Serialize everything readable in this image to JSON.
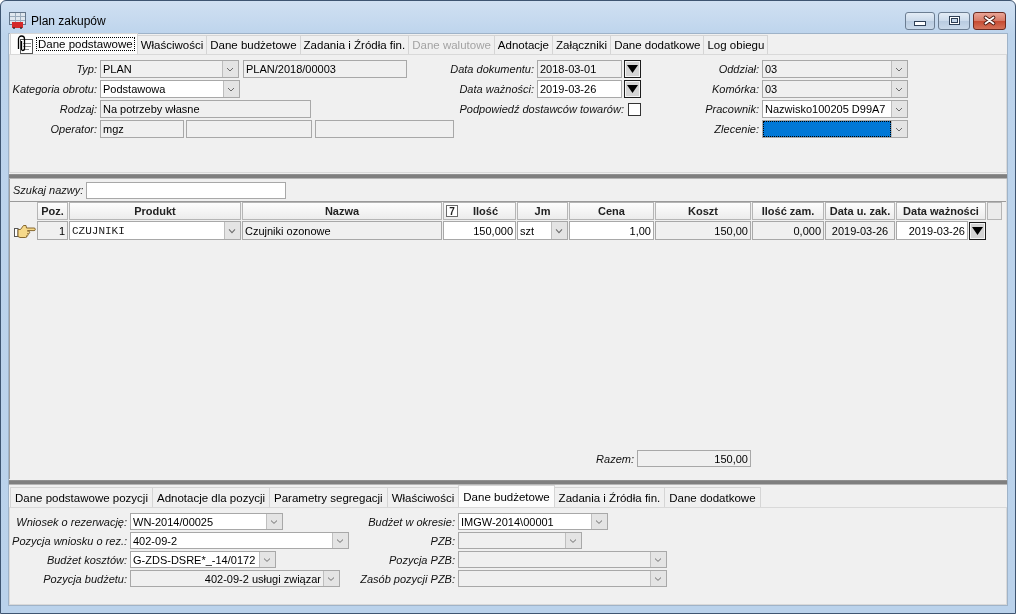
{
  "window": {
    "title": "Plan zakupów"
  },
  "tabs": [
    {
      "label": "Dane podstawowe",
      "selected": true,
      "disabled": false
    },
    {
      "label": "Właściwości",
      "selected": false,
      "disabled": false
    },
    {
      "label": "Dane budżetowe",
      "selected": false,
      "disabled": false
    },
    {
      "label": "Zadania i Źródła fin.",
      "selected": false,
      "disabled": false
    },
    {
      "label": "Dane walutowe",
      "selected": false,
      "disabled": true
    },
    {
      "label": "Adnotacje",
      "selected": false,
      "disabled": false
    },
    {
      "label": "Załączniki",
      "selected": false,
      "disabled": false
    },
    {
      "label": "Dane dodatkowe",
      "selected": false,
      "disabled": false
    },
    {
      "label": "Log obiegu",
      "selected": false,
      "disabled": false
    }
  ],
  "header_form": {
    "left": [
      {
        "label": "Typ:",
        "controls": [
          {
            "kind": "combo",
            "value": "PLAN",
            "readonly": true
          },
          {
            "kind": "text",
            "value": "PLAN/2018/00003",
            "readonly": true
          }
        ]
      },
      {
        "label": "Kategoria obrotu:",
        "controls": [
          {
            "kind": "combo",
            "value": "Podstawowa",
            "readonly": false
          }
        ]
      },
      {
        "label": "Rodzaj:",
        "controls": [
          {
            "kind": "text",
            "value": "Na potrzeby własne",
            "readonly": true
          }
        ]
      },
      {
        "label": "Operator:",
        "controls": [
          {
            "kind": "text",
            "value": "mgz",
            "readonly": true
          },
          {
            "kind": "text",
            "readonly": true
          },
          {
            "kind": "text",
            "readonly": true
          }
        ]
      }
    ],
    "middle": [
      {
        "label": "Data dokumentu:",
        "kind": "date",
        "value": "2018-03-01",
        "readonly": true
      },
      {
        "label": "Data ważności:",
        "kind": "date",
        "value": "2019-03-26",
        "readonly": false
      },
      {
        "label": "Podpowiedź dostawców towarów:",
        "kind": "checkbox",
        "checked": false
      }
    ],
    "right": [
      {
        "label": "Oddział:",
        "kind": "combo",
        "value": "03",
        "readonly": true,
        "focused": false
      },
      {
        "label": "Komórka:",
        "kind": "combo",
        "value": "03",
        "readonly": true,
        "focused": false
      },
      {
        "label": "Pracownik:",
        "kind": "combo",
        "value": "Nazwisko100205 D99A7",
        "readonly": false,
        "focused": false
      },
      {
        "label": "Zlecenie:",
        "kind": "combo",
        "readonly": false,
        "focused": true
      }
    ]
  },
  "search": {
    "label": "Szukaj nazwy:"
  },
  "table": {
    "columns": [
      {
        "label": "Poz."
      },
      {
        "label": "Produkt"
      },
      {
        "label": "Nazwa"
      },
      {
        "label": "Ilość",
        "badge": "7"
      },
      {
        "label": "Jm"
      },
      {
        "label": "Cena"
      },
      {
        "label": "Koszt"
      },
      {
        "label": "Ilość zam."
      },
      {
        "label": "Data u. zak."
      },
      {
        "label": "Data ważności"
      }
    ],
    "rows": [
      {
        "current": true,
        "cells": [
          {
            "kind": "text",
            "value": "1",
            "readonly": true
          },
          {
            "kind": "combo",
            "value": "CZUJNIKI",
            "readonly": false
          },
          {
            "kind": "text",
            "value": "Czujniki ozonowe",
            "readonly": true
          },
          {
            "kind": "text",
            "value": "150,000",
            "readonly": false
          },
          {
            "kind": "combo",
            "value": "szt",
            "readonly": false
          },
          {
            "kind": "text",
            "value": "1,00",
            "readonly": false
          },
          {
            "kind": "text",
            "value": "150,00",
            "readonly": true
          },
          {
            "kind": "text",
            "value": "0,000",
            "readonly": true
          },
          {
            "kind": "text",
            "value": "2019-03-26",
            "readonly": true
          },
          {
            "kind": "date",
            "value": "2019-03-26",
            "readonly": false
          }
        ]
      }
    ]
  },
  "total": {
    "label": "Razem:",
    "value": "150,00"
  },
  "detail_tabs": [
    {
      "label": "Dane podstawowe pozycji",
      "selected": false
    },
    {
      "label": "Adnotacje dla pozycji",
      "selected": false
    },
    {
      "label": "Parametry segregacji",
      "selected": false
    },
    {
      "label": "Właściwości",
      "selected": false
    },
    {
      "label": "Dane budżetowe",
      "selected": true
    },
    {
      "label": "Zadania i Źródła fin.",
      "selected": false
    },
    {
      "label": "Dane dodatkowe",
      "selected": false
    }
  ],
  "detail_form": {
    "left": [
      {
        "label": "Wniosek o rezerwację:",
        "kind": "combo",
        "value": "WN-2014/00025",
        "readonly": false
      },
      {
        "label": "Pozycja wniosku o rez.:",
        "kind": "combo",
        "value": "402-09-2",
        "readonly": false
      },
      {
        "label": "Budżet kosztów:",
        "kind": "combo",
        "value": "G-ZDS-DSRE*_-14/0172",
        "readonly": false
      },
      {
        "label": "Pozycja budżetu:",
        "kind": "combo",
        "value": "402-09-2 usługi związar",
        "readonly": true
      }
    ],
    "right": [
      {
        "label": "Budżet w okresie:",
        "kind": "combo",
        "value": "IMGW-2014\\00001",
        "readonly": false
      },
      {
        "label": "PZB:",
        "kind": "combo",
        "readonly": true
      },
      {
        "label": "Pozycja PZB:",
        "kind": "combo",
        "readonly": true
      },
      {
        "label": "Zasób pozycji PZB:",
        "kind": "combo",
        "readonly": true
      }
    ]
  }
}
